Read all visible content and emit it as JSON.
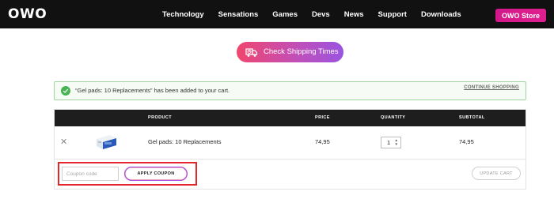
{
  "header": {
    "logo": "OWO",
    "nav": [
      "Technology",
      "Sensations",
      "Games",
      "Devs",
      "News",
      "Support",
      "Downloads"
    ],
    "store_button": "OWO Store"
  },
  "shipping": {
    "label": "Check Shipping Times",
    "icon": "truck-clock-icon"
  },
  "notice": {
    "message": "“Gel pads: 10 Replacements” has been added to your cart.",
    "continue_label": "CONTINUE SHOPPING"
  },
  "cart": {
    "columns": [
      "PRODUCT",
      "PRICE",
      "QUANTITY",
      "SUBTOTAL"
    ],
    "items": [
      {
        "name": "Gel pads: 10 Replacements",
        "price": "74,95",
        "quantity": "1",
        "subtotal": "74,95"
      }
    ],
    "coupon_placeholder": "Coupon code",
    "apply_label": "APPLY COUPON",
    "update_label": "UPDATE CART"
  },
  "colors": {
    "topbar": "#111111",
    "store_accent": "#d2178a",
    "shipping_gradient_start": "#f0466e",
    "shipping_gradient_end": "#9a54e0",
    "success": "#46b450",
    "highlight": "#e3262b"
  }
}
